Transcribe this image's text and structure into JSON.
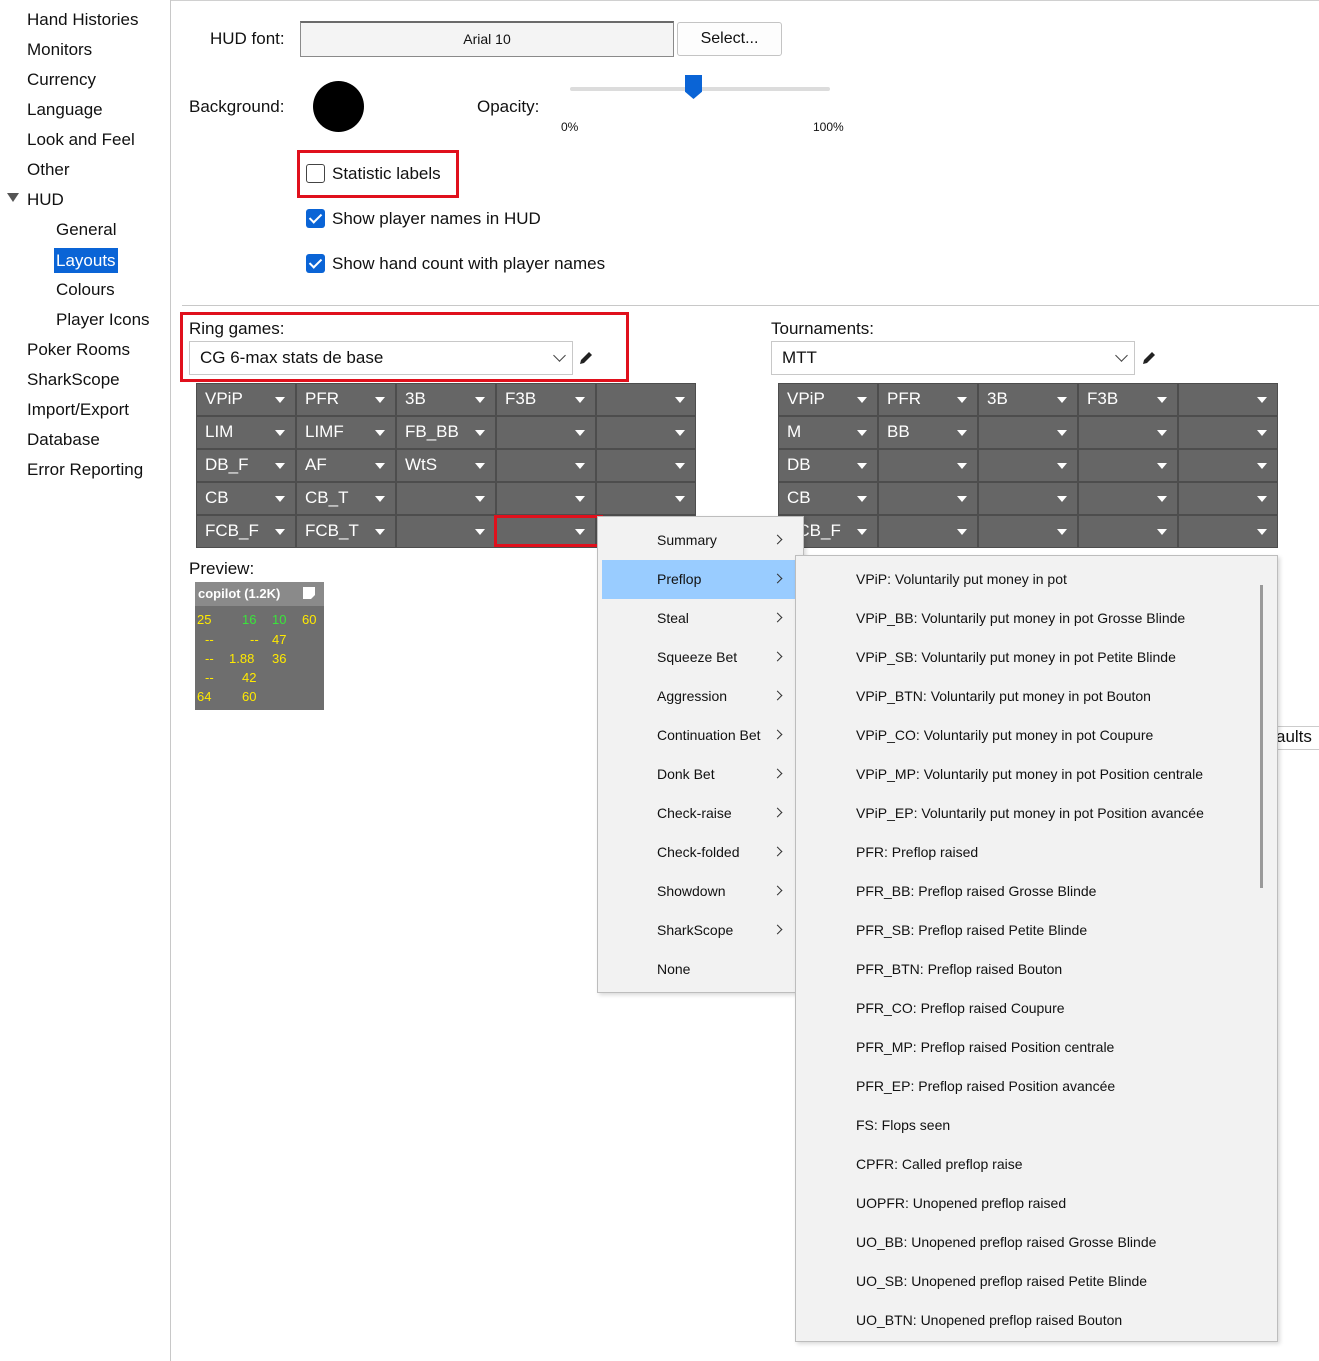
{
  "sidebar": {
    "items": [
      {
        "label": "Hand Histories"
      },
      {
        "label": "Monitors"
      },
      {
        "label": "Currency"
      },
      {
        "label": "Language"
      },
      {
        "label": "Look and Feel"
      },
      {
        "label": "Other"
      },
      {
        "label": "HUD"
      },
      {
        "label": "General"
      },
      {
        "label": "Layouts"
      },
      {
        "label": "Colours"
      },
      {
        "label": "Player Icons"
      },
      {
        "label": "Poker Rooms"
      },
      {
        "label": "SharkScope"
      },
      {
        "label": "Import/Export"
      },
      {
        "label": "Database"
      },
      {
        "label": "Error Reporting"
      }
    ],
    "selected": "Layouts"
  },
  "hud": {
    "font_label": "HUD font:",
    "font_value": "Arial 10",
    "select_button": "Select...",
    "background_label": "Background:",
    "opacity_label": "Opacity:",
    "opacity_min": "0%",
    "opacity_max": "100%",
    "opacity_value": 0.47,
    "background_color": "#000000"
  },
  "checkboxes": {
    "statistic_labels": {
      "label": "Statistic labels",
      "checked": false
    },
    "show_player_names": {
      "label": "Show player names in HUD",
      "checked": true
    },
    "show_hand_count": {
      "label": "Show hand count with player names",
      "checked": true
    }
  },
  "ring": {
    "label": "Ring games:",
    "layout": "CG 6-max stats de base",
    "grid": [
      [
        "VPiP",
        "PFR",
        "3B",
        "F3B",
        ""
      ],
      [
        "LIM",
        "LIMF",
        "FB_BB",
        "",
        ""
      ],
      [
        "DB_F",
        "AF",
        "WtS",
        "",
        ""
      ],
      [
        "CB",
        "CB_T",
        "",
        "",
        ""
      ],
      [
        "FCB_F",
        "FCB_T",
        "",
        "",
        ""
      ]
    ]
  },
  "tournaments": {
    "label": "Tournaments:",
    "layout": "MTT",
    "grid": [
      [
        "VPiP",
        "PFR",
        "3B",
        "F3B",
        ""
      ],
      [
        "M",
        "BB",
        "",
        "",
        ""
      ],
      [
        "DB",
        "",
        "",
        "",
        ""
      ],
      [
        "CB",
        "",
        "",
        "",
        ""
      ],
      [
        "FCB_F",
        "",
        "",
        "",
        ""
      ]
    ]
  },
  "preview": {
    "label": "Preview:",
    "title": "copilot (1.2K)",
    "rows": [
      [
        "25",
        "16",
        "10",
        "60"
      ],
      [
        "--",
        "--",
        "47"
      ],
      [
        "--",
        "1.88",
        "36"
      ],
      [
        "--",
        "42"
      ],
      [
        "64",
        "60"
      ]
    ]
  },
  "menu": {
    "categories": [
      "Summary",
      "Preflop",
      "Steal",
      "Squeeze Bet",
      "Aggression",
      "Continuation Bet",
      "Donk Bet",
      "Check-raise",
      "Check-folded",
      "Showdown",
      "SharkScope",
      "None"
    ],
    "active": "Preflop",
    "preflop_stats": [
      "VPiP: Voluntarily put money in pot",
      "VPiP_BB: Voluntarily put money in pot Grosse Blinde",
      "VPiP_SB: Voluntarily put money in pot Petite Blinde",
      "VPiP_BTN: Voluntarily put money in pot Bouton",
      "VPiP_CO: Voluntarily put money in pot Coupure",
      "VPiP_MP: Voluntarily put money in pot Position centrale",
      "VPiP_EP: Voluntarily put money in pot Position avancée",
      "PFR: Preflop raised",
      "PFR_BB: Preflop raised Grosse Blinde",
      "PFR_SB: Preflop raised Petite Blinde",
      "PFR_BTN: Preflop raised Bouton",
      "PFR_CO: Preflop raised Coupure",
      "PFR_MP: Preflop raised Position centrale",
      "PFR_EP: Preflop raised Position avancée",
      "FS: Flops seen",
      "CPFR: Called preflop raise",
      "UOPFR: Unopened preflop raised",
      "UO_BB: Unopened preflop raised Grosse Blinde",
      "UO_SB: Unopened preflop raised Petite Blinde",
      "UO_BTN: Unopened preflop raised Bouton"
    ]
  },
  "partial_button": "aults",
  "colors": {
    "accent": "#0a64d6",
    "highlight_box": "#e0101c",
    "menu_active": "#99ccff",
    "stat_yellow": "#ffea00",
    "stat_green": "#39e639"
  }
}
